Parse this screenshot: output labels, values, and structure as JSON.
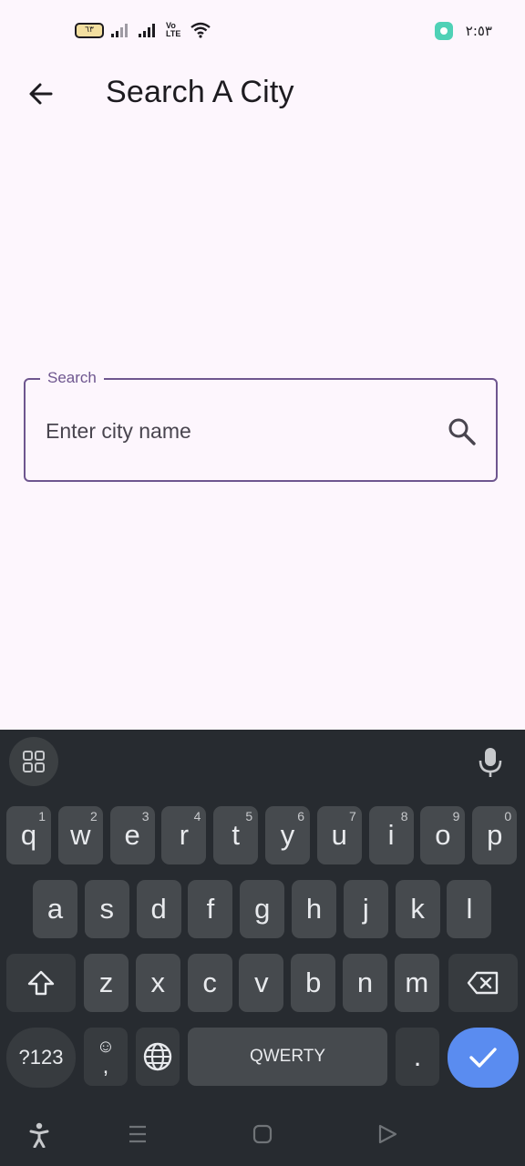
{
  "status_bar": {
    "battery_level": "٦٣",
    "network_badge": "Vo LTE",
    "time": "٢:٥٣",
    "icons": [
      "battery-icon",
      "signal-icon",
      "signal-icon",
      "volte-icon",
      "wifi-icon",
      "app-notification-icon"
    ]
  },
  "appbar": {
    "title": "Search A City"
  },
  "search": {
    "label": "Search",
    "placeholder": "Enter city name",
    "value": ""
  },
  "keyboard": {
    "row1": [
      {
        "key": "q",
        "hint": "1"
      },
      {
        "key": "w",
        "hint": "2"
      },
      {
        "key": "e",
        "hint": "3"
      },
      {
        "key": "r",
        "hint": "4"
      },
      {
        "key": "t",
        "hint": "5"
      },
      {
        "key": "y",
        "hint": "6"
      },
      {
        "key": "u",
        "hint": "7"
      },
      {
        "key": "i",
        "hint": "8"
      },
      {
        "key": "o",
        "hint": "9"
      },
      {
        "key": "p",
        "hint": "0"
      }
    ],
    "row2": [
      "a",
      "s",
      "d",
      "f",
      "g",
      "h",
      "j",
      "k",
      "l"
    ],
    "row3": [
      "z",
      "x",
      "c",
      "v",
      "b",
      "n",
      "m"
    ],
    "symbols_label": "?123",
    "emoji_label": "☺",
    "comma_label": ",",
    "space_label": "QWERTY",
    "period_label": "."
  },
  "colors": {
    "accent": "#6e568f",
    "background": "#fdf6fd",
    "keyboard_bg": "#272b30",
    "enter_key": "#5a8cf0"
  }
}
